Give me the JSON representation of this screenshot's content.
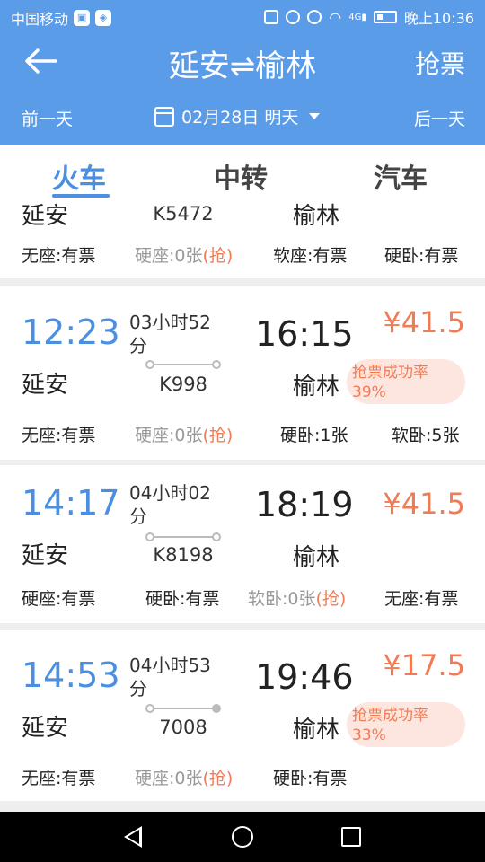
{
  "status": {
    "carrier": "中国移动",
    "time": "晚上10:36",
    "signal_label": "4G"
  },
  "header": {
    "title": "延安⇌榆林",
    "grab_label": "抢票",
    "prev_day": "前一天",
    "next_day": "后一天",
    "date": "02月28日 明天"
  },
  "tabs": [
    {
      "label": "火车"
    },
    {
      "label": "中转"
    },
    {
      "label": "汽车"
    }
  ],
  "trains": [
    {
      "from": "延安",
      "to": "榆林",
      "train_no": "K5472",
      "seats": [
        {
          "text": "无座:有票",
          "dim": false
        },
        {
          "text": "硬座:0张",
          "grab": "(抢)",
          "dim": true
        },
        {
          "text": "软座:有票",
          "dim": false
        },
        {
          "text": "硬卧:有票",
          "dim": false
        }
      ]
    },
    {
      "dep": "12:23",
      "arr": "16:15",
      "dur1": "03小时52",
      "dur2": "分",
      "train_no": "K998",
      "from": "延安",
      "to": "榆林",
      "price": "¥41.5",
      "rate": {
        "label": "抢票成功率",
        "value": "39%"
      },
      "seats": [
        {
          "text": "无座:有票",
          "dim": false
        },
        {
          "text": "硬座:0张",
          "grab": "(抢)",
          "dim": true
        },
        {
          "text": "硬卧:1张",
          "dim": false
        },
        {
          "text": "软卧:5张",
          "dim": false
        }
      ]
    },
    {
      "dep": "14:17",
      "arr": "18:19",
      "dur1": "04小时02",
      "dur2": "分",
      "train_no": "K8198",
      "from": "延安",
      "to": "榆林",
      "price": "¥41.5",
      "seats": [
        {
          "text": "硬座:有票",
          "dim": false
        },
        {
          "text": "硬卧:有票",
          "dim": false
        },
        {
          "text": "软卧:0张",
          "grab": "(抢)",
          "dim": true
        },
        {
          "text": "无座:有票",
          "dim": false
        }
      ]
    },
    {
      "dep": "14:53",
      "arr": "19:46",
      "dur1": "04小时53",
      "dur2": "分",
      "train_no": "7008",
      "from": "延安",
      "to": "榆林",
      "price": "¥17.5",
      "rate": {
        "label": "抢票成功率",
        "value": "33%"
      },
      "seats": [
        {
          "text": "无座:有票",
          "dim": false
        },
        {
          "text": "硬座:0张",
          "grab": "(抢)",
          "dim": true
        },
        {
          "text": "硬卧:有票",
          "dim": false
        }
      ]
    }
  ]
}
